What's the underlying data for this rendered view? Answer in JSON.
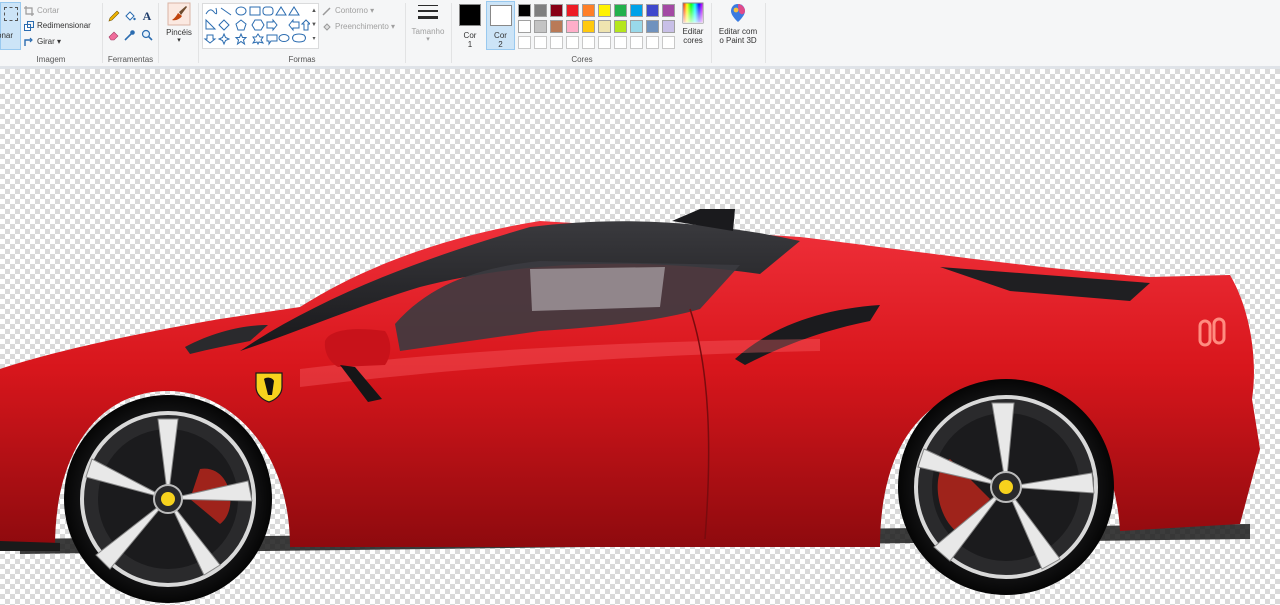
{
  "imagem": {
    "select_label": "onar",
    "crop_label": "Cortar",
    "resize_label": "Redimensionar",
    "rotate_label": "Girar ▾",
    "group_label": "Imagem"
  },
  "ferramentas": {
    "group_label": "Ferramentas",
    "text_tool_glyph": "A"
  },
  "pinceis": {
    "label": "Pincéis",
    "caret": "▾"
  },
  "formas": {
    "outline_label": "Contorno ▾",
    "fill_label": "Preenchimento ▾",
    "group_label": "Formas"
  },
  "tamanho": {
    "label": "Tamanho",
    "caret": "▾"
  },
  "cores": {
    "color1_label_a": "Cor",
    "color1_label_b": "1",
    "color2_label_a": "Cor",
    "color2_label_b": "2",
    "group_label": "Cores",
    "color1": "#000000",
    "color2": "#ffffff",
    "palette_row1": [
      "#000000",
      "#7f7f7f",
      "#880015",
      "#ed1c24",
      "#ff7f27",
      "#fff200",
      "#22b14c",
      "#00a2e8",
      "#3f48cc",
      "#a349a4"
    ],
    "palette_row2": [
      "#ffffff",
      "#c3c3c3",
      "#b97a57",
      "#ffaec9",
      "#ffc90e",
      "#efe4b0",
      "#b5e61d",
      "#99d9ea",
      "#7092be",
      "#c8bfe7"
    ],
    "edit_colors_a": "Editar",
    "edit_colors_b": "cores",
    "paint3d_a": "Editar com",
    "paint3d_b": "o Paint 3D"
  },
  "canvas": {
    "car_body_color": "#d8161c",
    "accent": "#0078d7"
  }
}
